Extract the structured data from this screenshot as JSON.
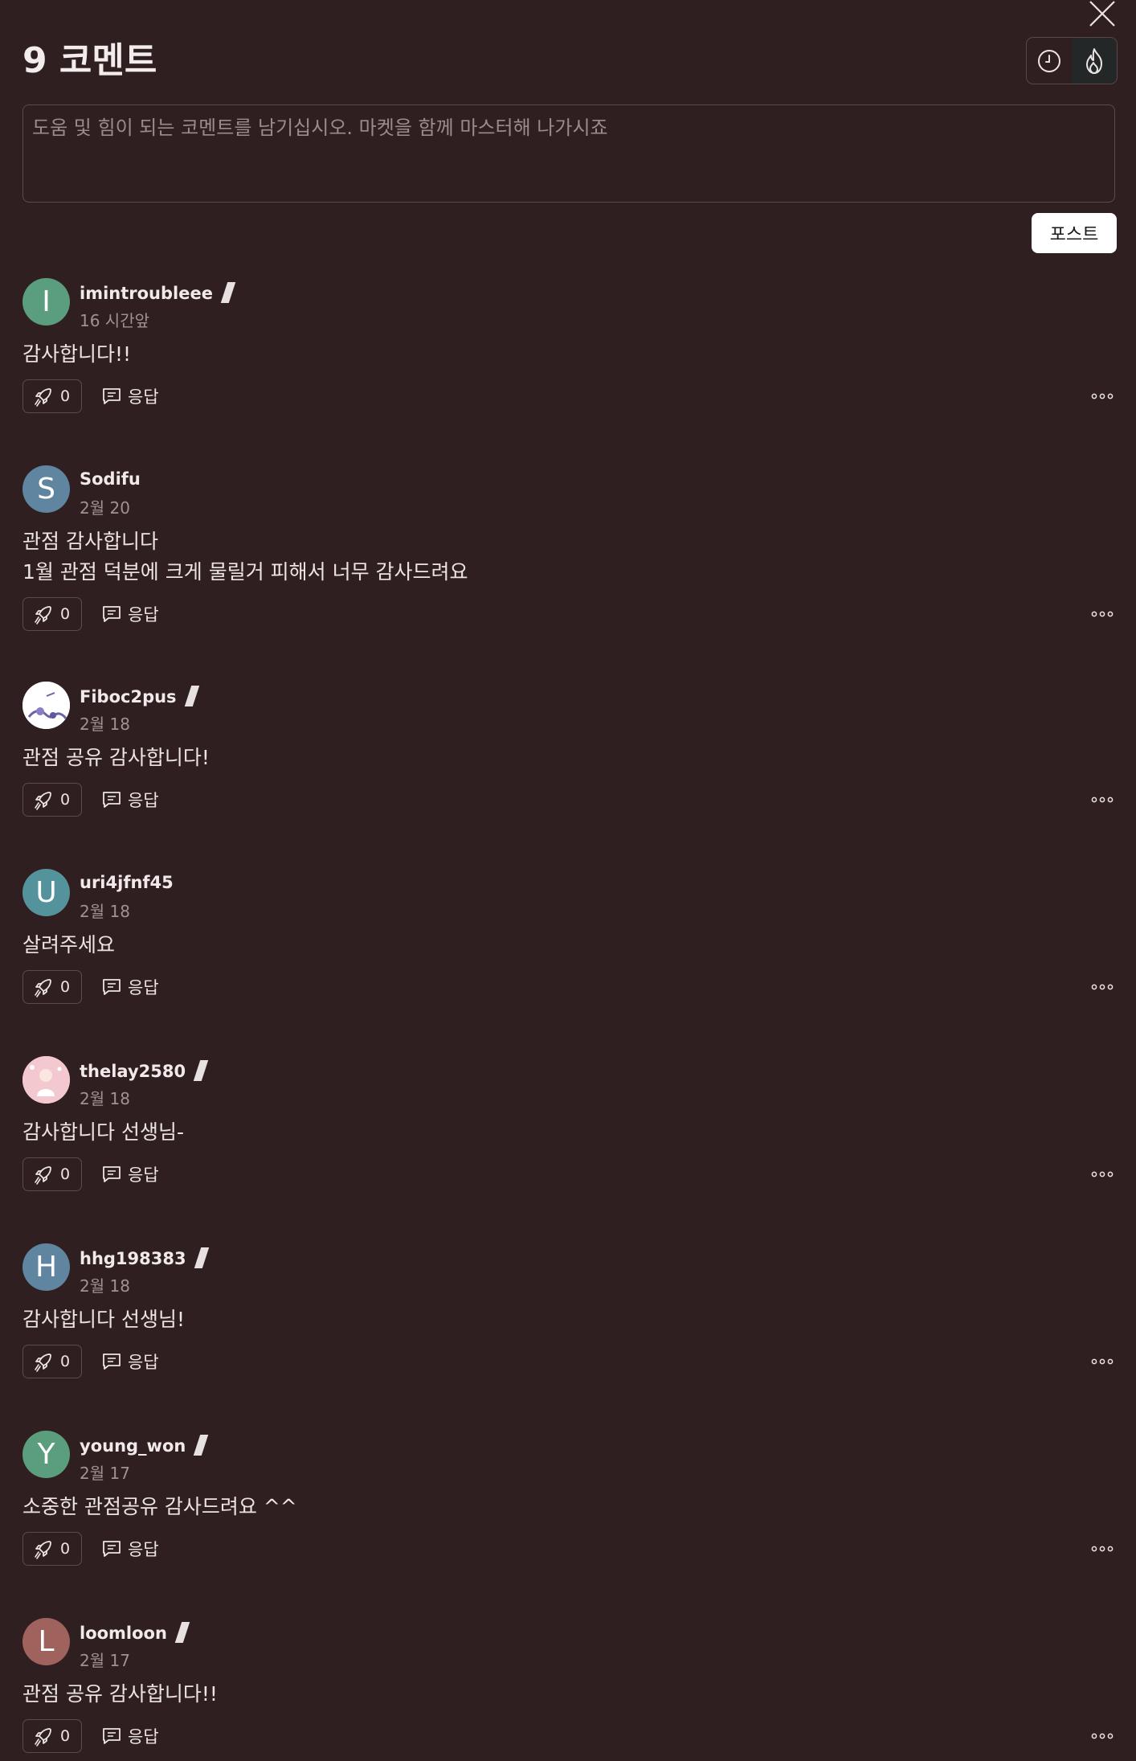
{
  "header": {
    "title": "9 코멘트"
  },
  "composer": {
    "placeholder": "도움 및 힘이 되는 코멘트를 남기십시오. 마켓을 함께 마스터해 나가시죠",
    "post_label": "포스트"
  },
  "sort": {
    "active": "popular",
    "options": [
      "recent",
      "popular"
    ]
  },
  "comments": [
    {
      "username": "imintroubleee",
      "badge": true,
      "time": "16 시간앞",
      "text_lines": [
        "감사합니다!!"
      ],
      "likes": "0",
      "reply_label": "응답",
      "avatar_letter": "I",
      "avatar_color": "#5a9e7d"
    },
    {
      "username": "Sodifu",
      "badge": false,
      "time": "2월 20",
      "text_lines": [
        "관점 감사합니다",
        "1월 관점 덕분에 크게 물릴거 피해서 너무 감사드려요"
      ],
      "likes": "0",
      "reply_label": "응답",
      "avatar_letter": "S",
      "avatar_color": "#5f85a0"
    },
    {
      "username": "Fiboc2pus",
      "badge": true,
      "time": "2월 18",
      "text_lines": [
        "관점 공유 감사합니다!"
      ],
      "likes": "0",
      "reply_label": "응답",
      "avatar_letter": "",
      "avatar_color": "#ffffff"
    },
    {
      "username": "uri4jfnf45",
      "badge": false,
      "time": "2월 18",
      "text_lines": [
        "살려주세요"
      ],
      "likes": "0",
      "reply_label": "응답",
      "avatar_letter": "U",
      "avatar_color": "#54939c"
    },
    {
      "username": "thelay2580",
      "badge": true,
      "time": "2월 18",
      "text_lines": [
        "감사합니다 선생님-"
      ],
      "likes": "0",
      "reply_label": "응답",
      "avatar_letter": "",
      "avatar_color": "#f4c8cf"
    },
    {
      "username": "hhg198383",
      "badge": true,
      "time": "2월 18",
      "text_lines": [
        "감사합니다 선생님!"
      ],
      "likes": "0",
      "reply_label": "응답",
      "avatar_letter": "H",
      "avatar_color": "#5f85a0"
    },
    {
      "username": "young_won",
      "badge": true,
      "time": "2월 17",
      "text_lines": [
        "소중한 관점공유 감사드려요 ^^"
      ],
      "likes": "0",
      "reply_label": "응답",
      "avatar_letter": "Y",
      "avatar_color": "#5a9e7d"
    },
    {
      "username": "loomloon",
      "badge": true,
      "time": "2월 17",
      "text_lines": [
        "관점 공유 감사합니다!!"
      ],
      "likes": "0",
      "reply_label": "응답",
      "avatar_letter": "L",
      "avatar_color": "#a0625c"
    }
  ]
}
